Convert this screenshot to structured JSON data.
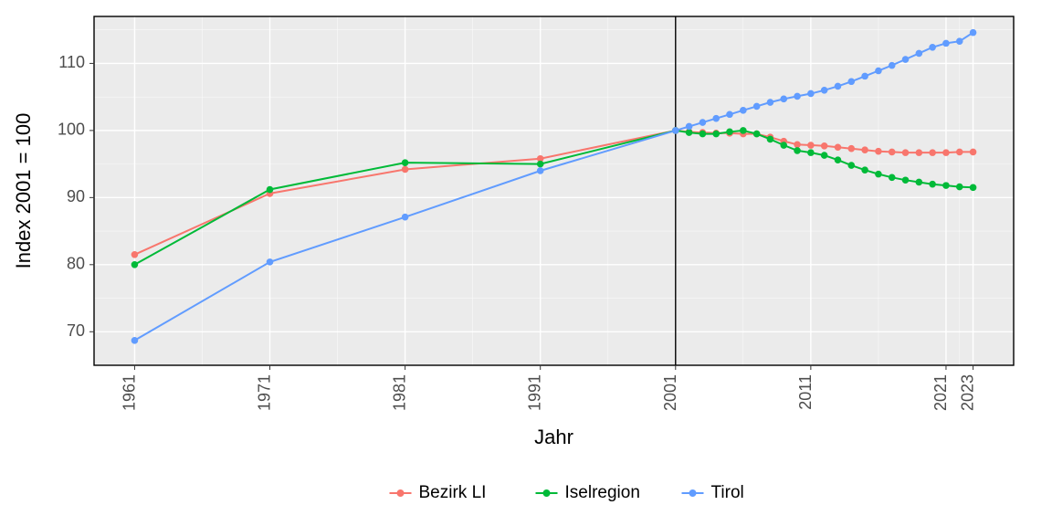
{
  "chart_data": {
    "type": "line",
    "xlabel": "Jahr",
    "ylabel": "Index 2001 = 100",
    "xlim": [
      1958,
      2026
    ],
    "ylim": [
      65,
      117
    ],
    "x_ticks": [
      1961,
      1971,
      1981,
      1991,
      2001,
      2011,
      2021,
      2023
    ],
    "y_ticks": [
      70,
      80,
      90,
      100,
      110
    ],
    "reference_x": 2001,
    "legend_position": "bottom",
    "series": [
      {
        "name": "Bezirk LI",
        "color": "#f8766d",
        "x": [
          1961,
          1971,
          1981,
          1991,
          2001,
          2002,
          2003,
          2004,
          2005,
          2006,
          2007,
          2008,
          2009,
          2010,
          2011,
          2012,
          2013,
          2014,
          2015,
          2016,
          2017,
          2018,
          2019,
          2020,
          2021,
          2022,
          2023
        ],
        "values": [
          81.5,
          90.6,
          94.2,
          95.8,
          100.0,
          99.8,
          99.7,
          99.6,
          99.6,
          99.5,
          99.5,
          99.0,
          98.4,
          97.9,
          97.8,
          97.7,
          97.5,
          97.3,
          97.1,
          96.9,
          96.8,
          96.7,
          96.7,
          96.7,
          96.7,
          96.8,
          96.8
        ]
      },
      {
        "name": "Iselregion",
        "color": "#00ba38",
        "x": [
          1961,
          1971,
          1981,
          1991,
          2001,
          2002,
          2003,
          2004,
          2005,
          2006,
          2007,
          2008,
          2009,
          2010,
          2011,
          2012,
          2013,
          2014,
          2015,
          2016,
          2017,
          2018,
          2019,
          2020,
          2021,
          2022,
          2023
        ],
        "values": [
          80.0,
          91.2,
          95.2,
          95.0,
          100.0,
          99.7,
          99.5,
          99.5,
          99.8,
          100.0,
          99.5,
          98.7,
          97.8,
          97.0,
          96.7,
          96.3,
          95.6,
          94.8,
          94.1,
          93.5,
          93.0,
          92.6,
          92.3,
          92.0,
          91.8,
          91.6,
          91.5
        ]
      },
      {
        "name": "Tirol",
        "color": "#619cff",
        "x": [
          1961,
          1971,
          1981,
          1991,
          2001,
          2002,
          2003,
          2004,
          2005,
          2006,
          2007,
          2008,
          2009,
          2010,
          2011,
          2012,
          2013,
          2014,
          2015,
          2016,
          2017,
          2018,
          2019,
          2020,
          2021,
          2022,
          2023
        ],
        "values": [
          68.7,
          80.4,
          87.1,
          94.0,
          100.0,
          100.6,
          101.2,
          101.8,
          102.4,
          103.0,
          103.6,
          104.2,
          104.7,
          105.1,
          105.5,
          106.0,
          106.6,
          107.3,
          108.1,
          108.9,
          109.7,
          110.6,
          111.5,
          112.4,
          113.0,
          113.3,
          114.6
        ]
      }
    ]
  },
  "axis": {
    "x_title": "Jahr",
    "y_title": "Index 2001 = 100",
    "y_ticks": [
      "70",
      "80",
      "90",
      "100",
      "110"
    ],
    "x_ticks": [
      "1961",
      "1971",
      "1981",
      "1991",
      "2001",
      "2011",
      "2021",
      "2023"
    ]
  },
  "legend": {
    "items": [
      "Bezirk LI",
      "Iselregion",
      "Tirol"
    ]
  }
}
